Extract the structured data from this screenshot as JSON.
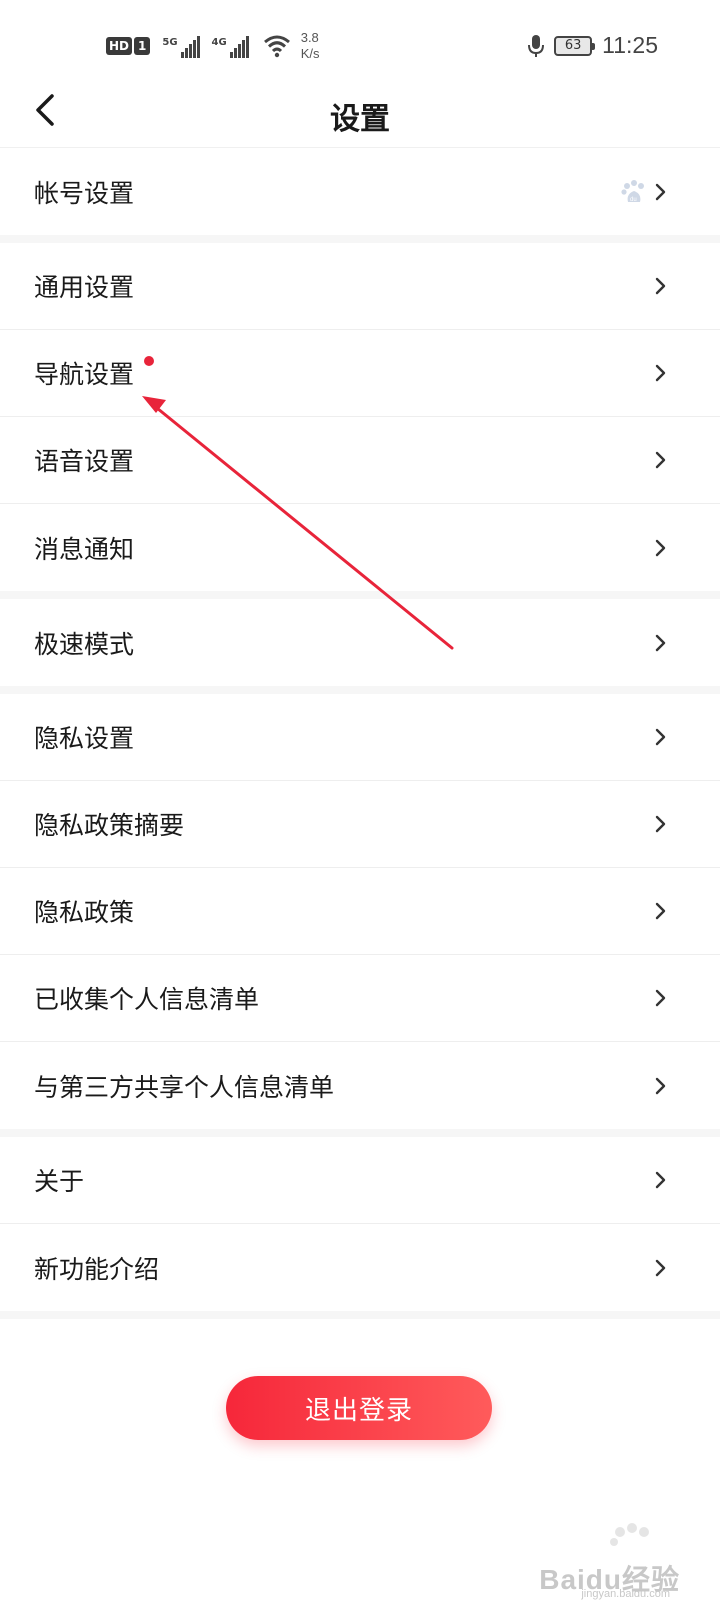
{
  "status_bar": {
    "hd": "HD",
    "sim": "1",
    "net1": "5G",
    "net2": "4G",
    "speed_value": "3.8",
    "speed_unit": "K/s",
    "battery": "63",
    "time": "11:25"
  },
  "header": {
    "title": "设置"
  },
  "sections": [
    {
      "items": [
        {
          "label": "帐号设置"
        }
      ]
    },
    {
      "items": [
        {
          "label": "通用设置"
        },
        {
          "label": "导航设置"
        },
        {
          "label": "语音设置"
        },
        {
          "label": "消息通知"
        }
      ]
    },
    {
      "items": [
        {
          "label": "极速模式"
        }
      ]
    },
    {
      "items": [
        {
          "label": "隐私设置"
        },
        {
          "label": "隐私政策摘要"
        },
        {
          "label": "隐私政策"
        },
        {
          "label": "已收集个人信息清单"
        },
        {
          "label": "与第三方共享个人信息清单"
        }
      ]
    },
    {
      "items": [
        {
          "label": "关于"
        },
        {
          "label": "新功能介绍"
        }
      ]
    }
  ],
  "logout": {
    "label": "退出登录"
  },
  "watermark": {
    "text": "Baidu经验",
    "url": "jingyan.baidu.com"
  },
  "colors": {
    "accent": "#f6273a",
    "annotation": "#e8243a"
  }
}
